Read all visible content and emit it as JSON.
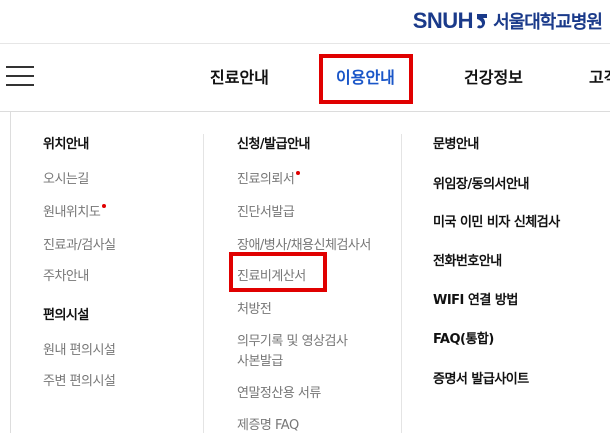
{
  "brand": {
    "logo_text": "SNUH",
    "name": "서울대학교병원",
    "color": "#1a3a8a"
  },
  "nav": {
    "menu_icon": "hamburger-menu-icon",
    "items": [
      {
        "label": "진료안내"
      },
      {
        "label": "이용안내"
      },
      {
        "label": "건강정보"
      },
      {
        "label": "고객"
      }
    ],
    "active_color": "#1a56c8",
    "highlight_color": "#e00000"
  },
  "menu": {
    "col1": {
      "head1": "위치안내",
      "items1": [
        "오시는길",
        "원내위치도",
        "진료과/검사실",
        "주차안내"
      ],
      "head2": "편의시설",
      "items2": [
        "원내 편의시설",
        "주변 편의시설"
      ]
    },
    "col2": {
      "head": "신청/발급안내",
      "items": [
        "진료의뢰서",
        "진단서발급",
        "장애/병사/채용신체검사서",
        "진료비계산서",
        "처방전",
        "의무기록 및 영상검사",
        "사본발급",
        "연말정산용 서류",
        "제증명 FAQ"
      ]
    },
    "col3": {
      "items": [
        "문병안내",
        "위임장/동의서안내",
        "미국 이민 비자 신체검사",
        "전화번호안내",
        "WIFI 연결 방법",
        "FAQ(통합)",
        "증명서 발급사이트"
      ]
    }
  }
}
